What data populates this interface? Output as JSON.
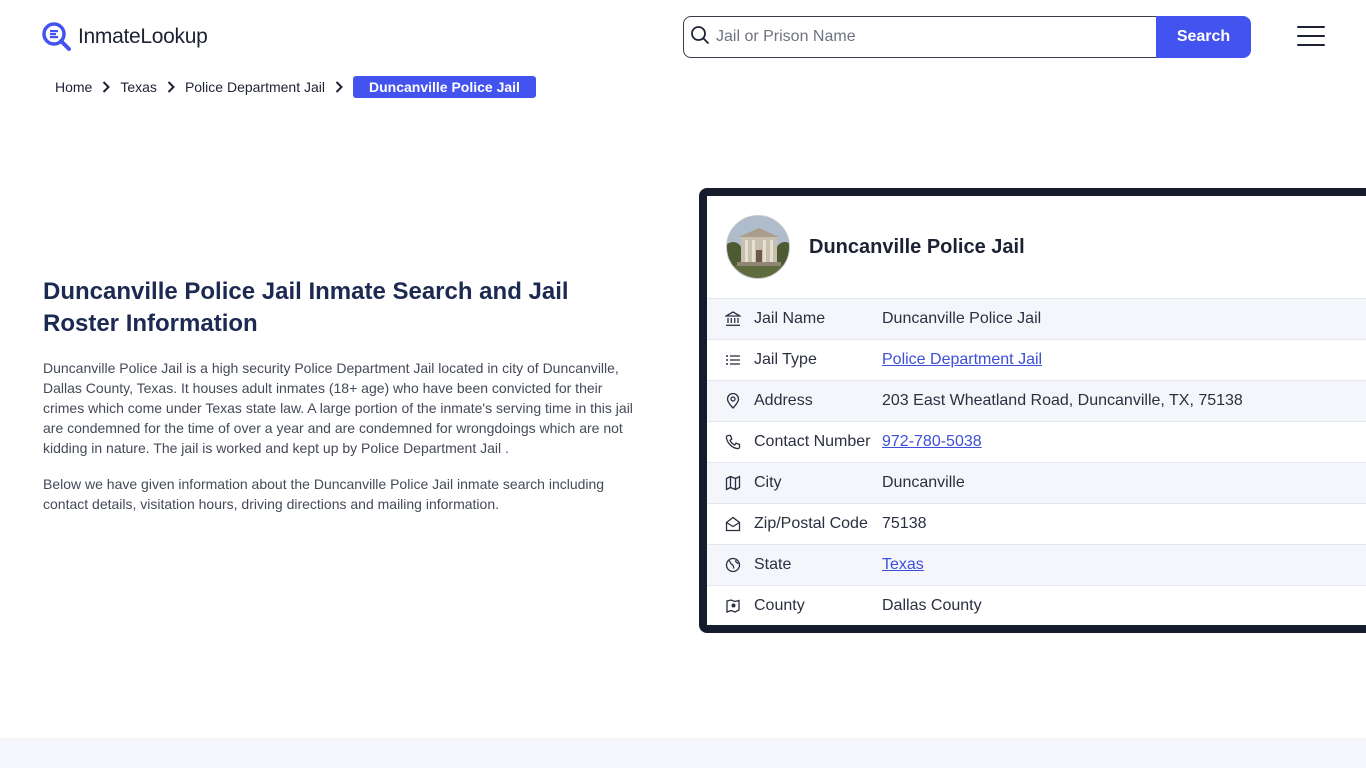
{
  "header": {
    "logo_text": "InmateLookup",
    "search_placeholder": "Jail or Prison Name",
    "search_button": "Search"
  },
  "breadcrumb": {
    "items": [
      "Home",
      "Texas",
      "Police Department Jail"
    ],
    "active": "Duncanville Police Jail"
  },
  "intro": {
    "heading": "Duncanville Police Jail Inmate Search and Jail Roster Information",
    "paragraph1": "Duncanville Police Jail is a high security Police Department Jail located in city of Duncanville, Dallas County, Texas. It houses adult inmates (18+ age) who have been convicted for their crimes which come under Texas state law. A large portion of the inmate's serving time in this jail are condemned for the time of over a year and are condemned for wrongdoings which are not kidding in nature. The jail is worked and kept up by Police Department Jail .",
    "paragraph2": "Below we have given information about the Duncanville Police Jail inmate search including contact details, visitation hours, driving directions and mailing information."
  },
  "card": {
    "title": "Duncanville Police Jail",
    "rows": [
      {
        "icon": "bank-icon",
        "label": "Jail Name",
        "value": "Duncanville Police Jail",
        "link": false
      },
      {
        "icon": "list-icon",
        "label": "Jail Type",
        "value": "Police Department Jail",
        "link": true
      },
      {
        "icon": "map-pin-icon",
        "label": "Address",
        "value": "203 East Wheatland Road, Duncanville, TX, 75138",
        "link": false
      },
      {
        "icon": "phone-icon",
        "label": "Contact Number",
        "value": "972-780-5038",
        "link": true
      },
      {
        "icon": "map-icon",
        "label": "City",
        "value": "Duncanville",
        "link": false
      },
      {
        "icon": "mail-open-icon",
        "label": "Zip/Postal Code",
        "value": "75138",
        "link": false
      },
      {
        "icon": "globe-icon",
        "label": "State",
        "value": "Texas",
        "link": true
      },
      {
        "icon": "county-icon",
        "label": "County",
        "value": "Dallas County",
        "link": false
      }
    ]
  },
  "colors": {
    "accent": "#4353f0",
    "heading": "#1c2a52",
    "card_border": "#151c2c",
    "link": "#3d4fd8"
  }
}
